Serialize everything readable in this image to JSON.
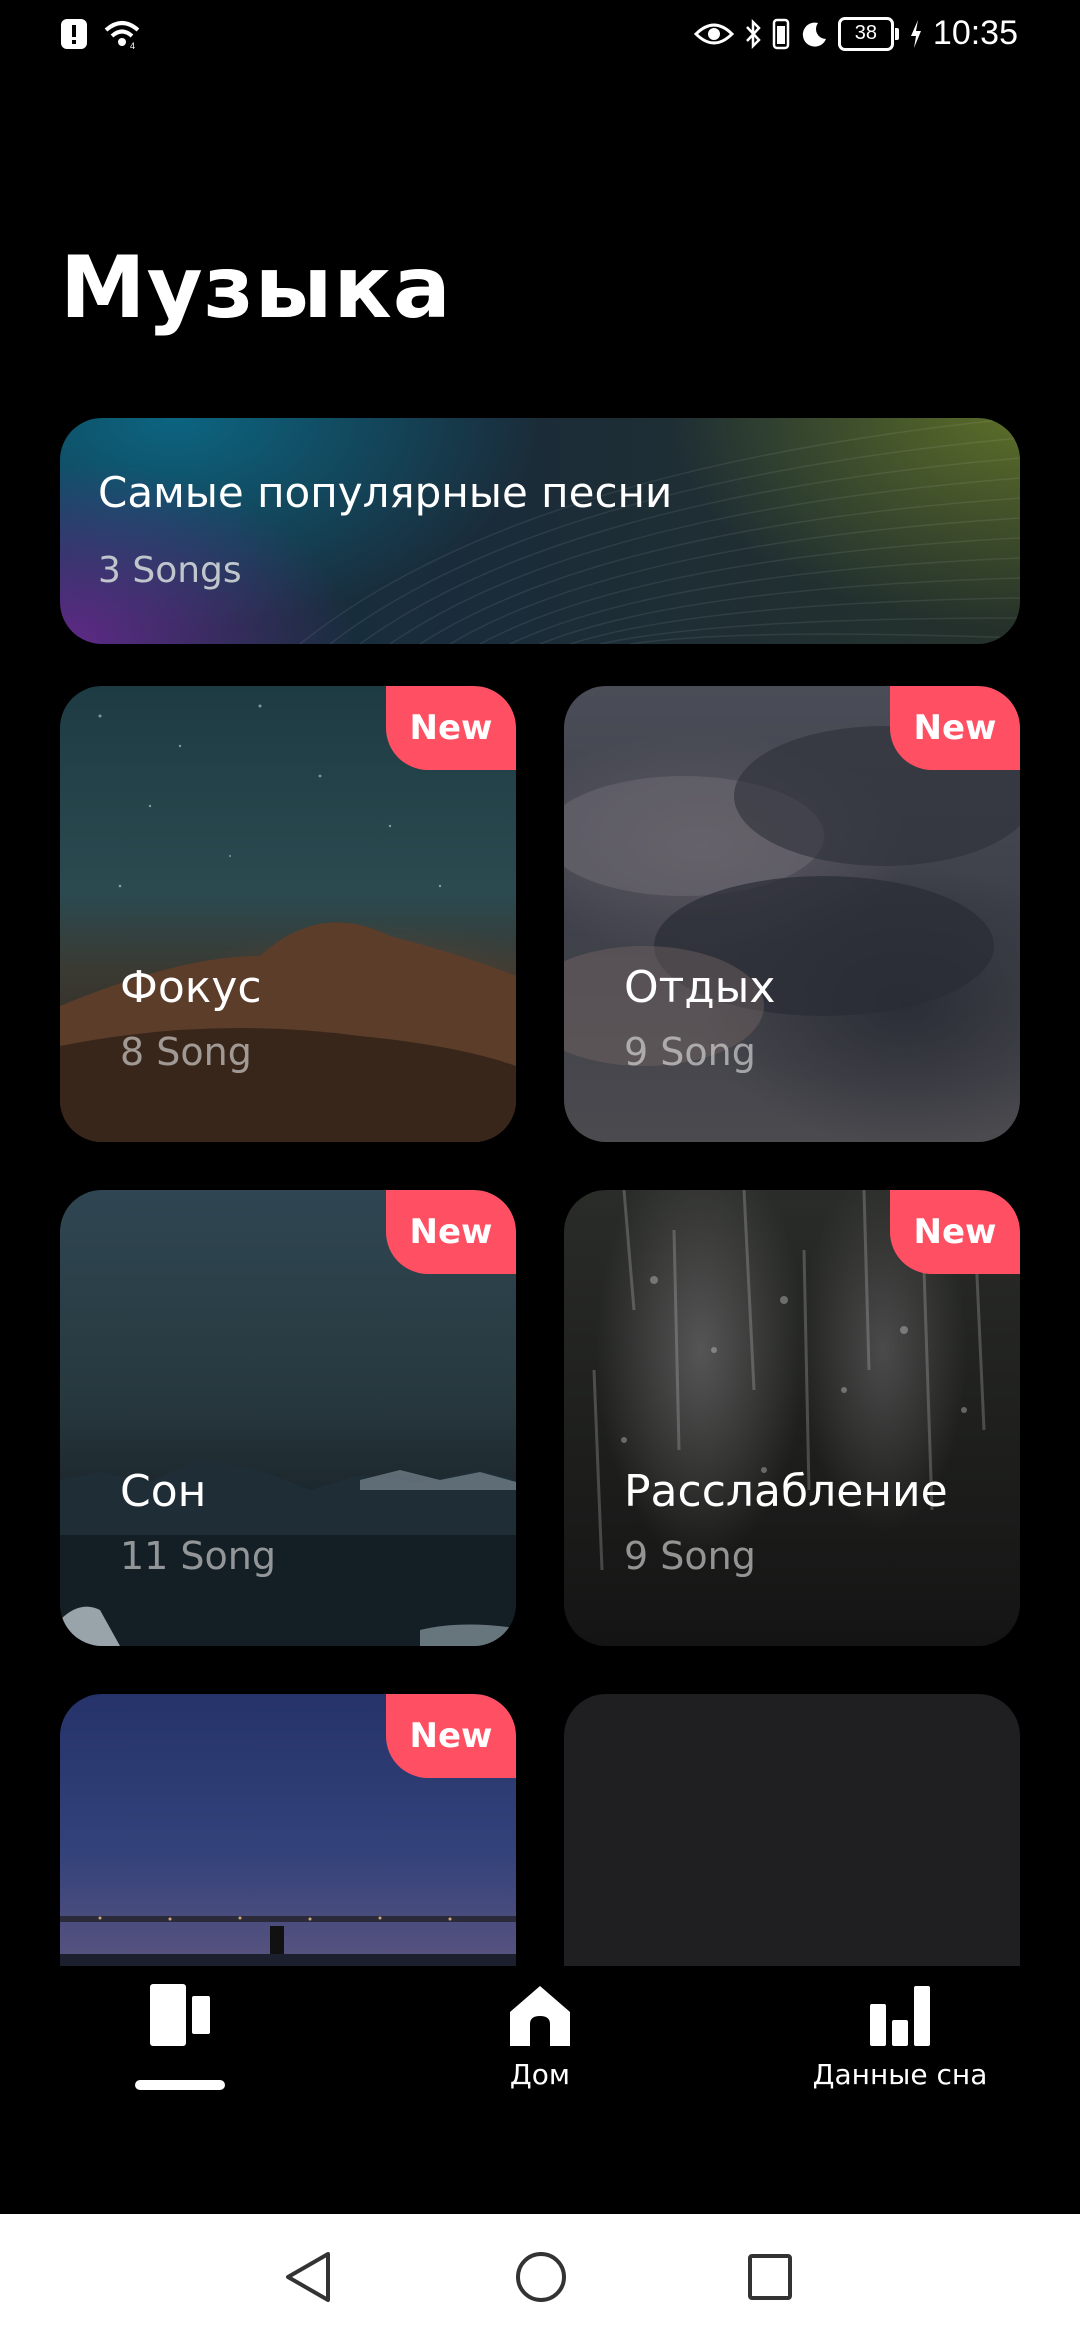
{
  "status_bar": {
    "time": "10:35",
    "battery_level": "38",
    "icons": [
      "alert-icon",
      "wifi-icon",
      "eye-icon",
      "bluetooth-icon",
      "vibrate-icon",
      "moon-icon",
      "charging-icon"
    ]
  },
  "page": {
    "title": "Музыка"
  },
  "featured": {
    "title": "Самые популярные песни",
    "subtitle": "3 Songs"
  },
  "cards": [
    {
      "title": "Фокус",
      "subtitle": "8 Song",
      "badge": "New"
    },
    {
      "title": "Отдых",
      "subtitle": "9 Song",
      "badge": "New"
    },
    {
      "title": "Сон",
      "subtitle": "11 Song",
      "badge": "New"
    },
    {
      "title": "Расслабление",
      "subtitle": "9 Song",
      "badge": "New"
    },
    {
      "badge": "New"
    }
  ],
  "bottom_nav": {
    "items": [
      {
        "icon": "music-icon",
        "label": "",
        "active": true
      },
      {
        "icon": "home-icon",
        "label": "Дом"
      },
      {
        "icon": "bar-chart-icon",
        "label": "Данные сна"
      }
    ]
  },
  "system_nav": {
    "icons": [
      "back-icon",
      "home-circle-icon",
      "recents-icon"
    ]
  },
  "colors": {
    "badge": "#ff5063",
    "background": "#000000",
    "empty_card": "#1f1f21"
  }
}
